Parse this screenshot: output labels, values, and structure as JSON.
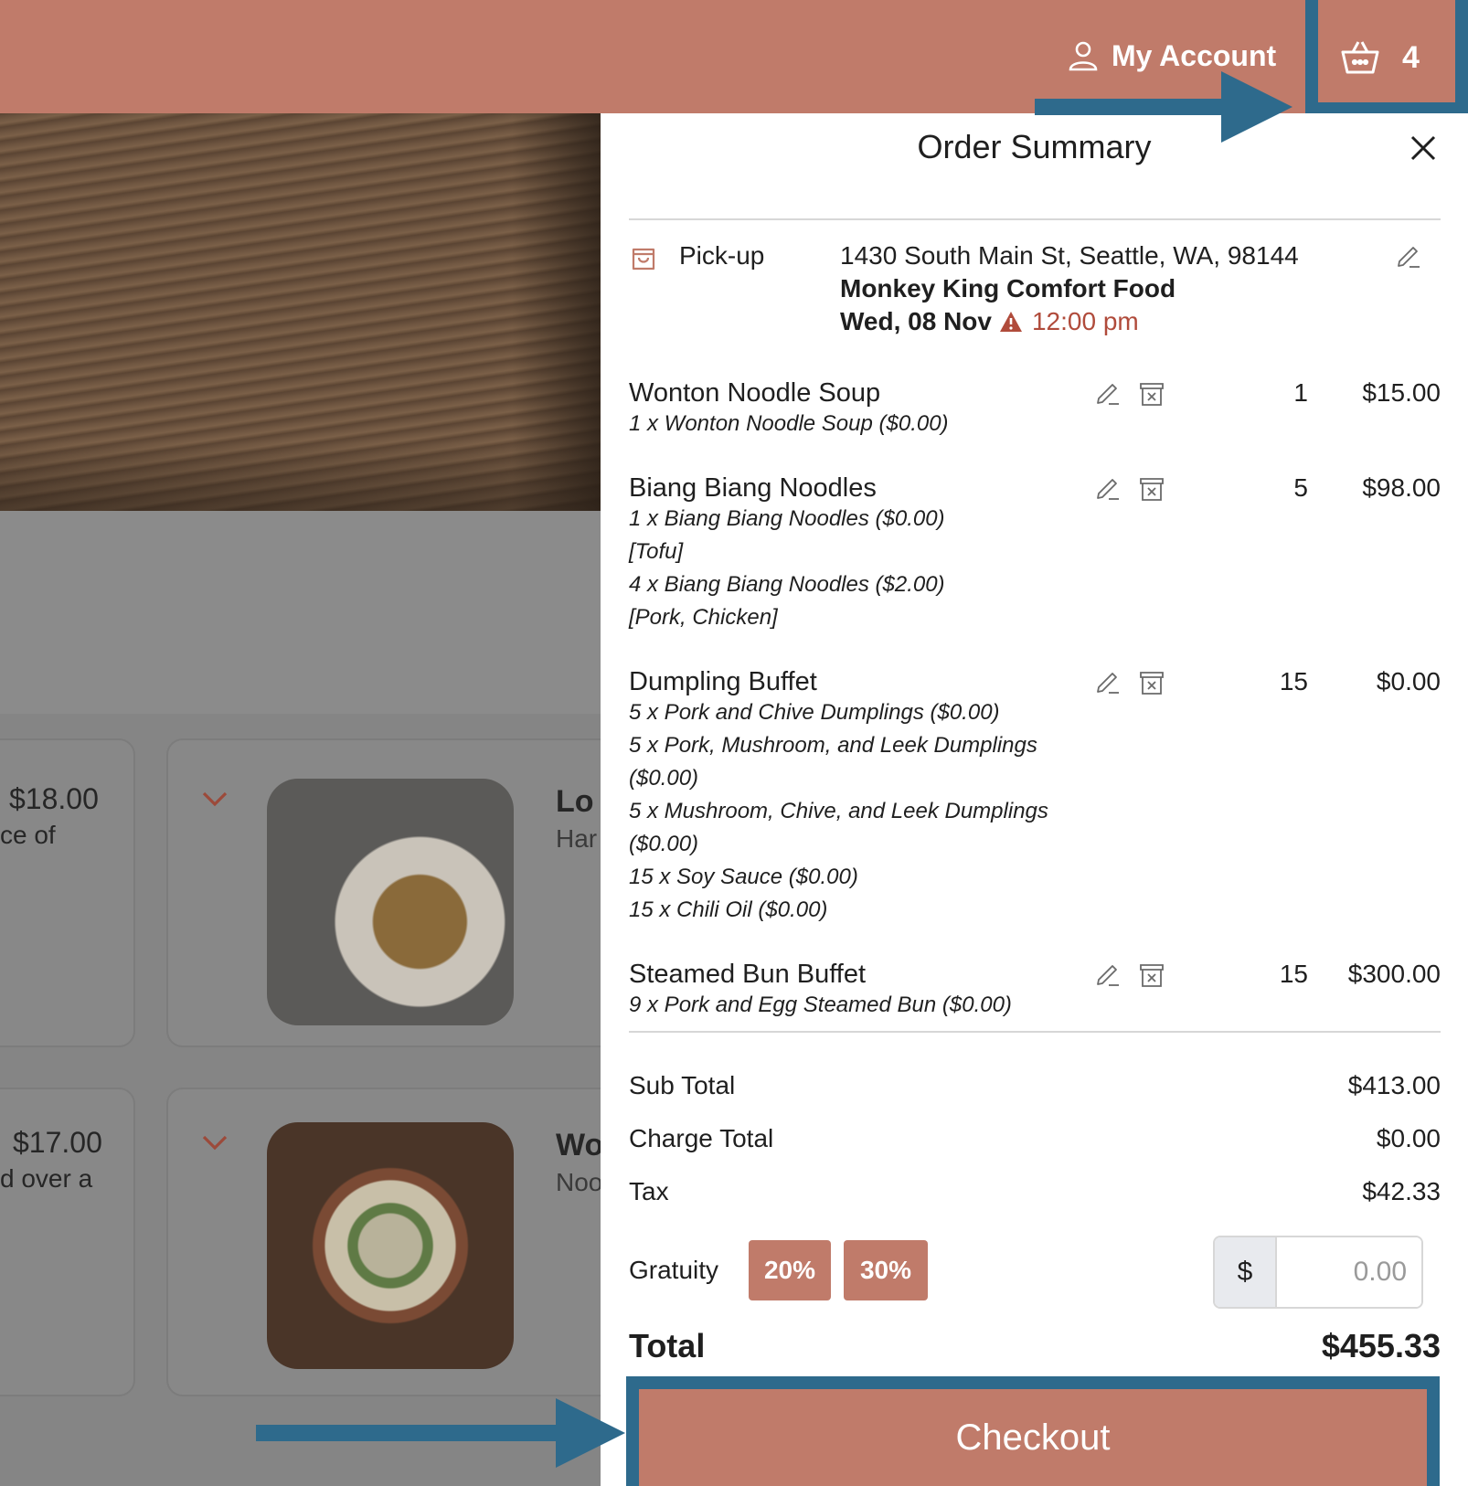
{
  "header": {
    "account_label": "My Account",
    "cart_count": "4"
  },
  "background": {
    "cards": [
      {
        "price": "$18.00",
        "desc_fragment": "ce of",
        "title_fragment": "Lo",
        "sub_fragment": "Har"
      },
      {
        "price": "$17.00",
        "desc_fragment": "d over a",
        "title_fragment": "Wo",
        "sub_fragment": "Noo"
      }
    ]
  },
  "order": {
    "title": "Order Summary",
    "pickup": {
      "label": "Pick-up",
      "address": "1430 South Main St, Seattle, WA, 98144",
      "restaurant": "Monkey King Comfort Food",
      "date": "Wed, 08 Nov",
      "time": "12:00 pm"
    },
    "items": [
      {
        "name": "Wonton Noodle Soup",
        "qty": "1",
        "price": "$15.00",
        "details": [
          "1 x Wonton Noodle Soup ($0.00)"
        ]
      },
      {
        "name": "Biang Biang Noodles",
        "qty": "5",
        "price": "$98.00",
        "details": [
          "1 x Biang Biang Noodles ($0.00)",
          "[Tofu]",
          "4 x Biang Biang Noodles ($2.00)",
          "[Pork, Chicken]"
        ]
      },
      {
        "name": "Dumpling Buffet",
        "qty": "15",
        "price": "$0.00",
        "details": [
          "5 x Pork and Chive Dumplings ($0.00)",
          "5 x Pork, Mushroom, and Leek Dumplings",
          "($0.00)",
          "5 x Mushroom, Chive, and Leek Dumplings",
          "($0.00)",
          "15 x Soy Sauce ($0.00)",
          "15 x Chili Oil ($0.00)"
        ]
      },
      {
        "name": "Steamed Bun Buffet",
        "qty": "15",
        "price": "$300.00",
        "details": [
          "9 x Pork and Egg Steamed Bun ($0.00)"
        ]
      }
    ],
    "sub_total_label": "Sub Total",
    "sub_total": "$413.00",
    "charge_total_label": "Charge Total",
    "charge_total": "$0.00",
    "tax_label": "Tax",
    "tax": "$42.33",
    "gratuity_label": "Gratuity",
    "gratuity_options": [
      "20%",
      "30%"
    ],
    "gratuity_currency": "$",
    "gratuity_placeholder": "0.00",
    "total_label": "Total",
    "total": "$455.33",
    "checkout_label": "Checkout"
  },
  "colors": {
    "brand": "#c07b6a",
    "annotation": "#2e6a8c",
    "warning": "#b04b3b"
  }
}
